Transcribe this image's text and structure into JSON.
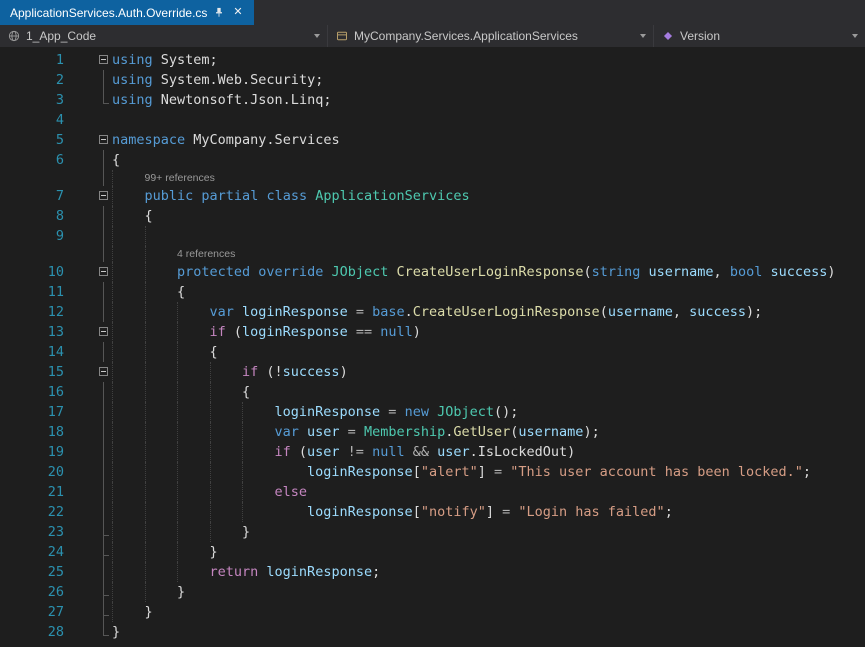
{
  "tab_bar": {
    "active_tab": {
      "title": "ApplicationServices.Auth.Override.cs",
      "pinned": true,
      "close_label": "✕"
    }
  },
  "nav_bar": {
    "dropdowns": [
      {
        "label": "1_App_Code",
        "icon": "globe-icon"
      },
      {
        "label": "MyCompany.Services.ApplicationServices",
        "icon": "class-icon"
      },
      {
        "label": "Version",
        "icon": "member-icon"
      }
    ]
  },
  "colors": {
    "tab_active_bg": "#0e62a0",
    "chrome_bg": "#2d2d30",
    "editor_bg": "#1e1e1e",
    "line_number": "#2b91af",
    "codelens": "#999999",
    "keyword": "#569cd6",
    "control": "#c586c0",
    "type": "#4ec9b0",
    "method": "#dcdcaa",
    "variable": "#9cdcfe",
    "string": "#d69d85",
    "operator": "#b4b4b4",
    "text": "#dcdcdc"
  },
  "editor": {
    "language": "C#",
    "lines": [
      {
        "num": 1,
        "fold": "box",
        "guides": 0,
        "tokens": [
          [
            "kw",
            "using"
          ],
          [
            "pl",
            " System;"
          ]
        ]
      },
      {
        "num": 2,
        "fold": "line",
        "guides": 0,
        "tokens": [
          [
            "kw",
            "using"
          ],
          [
            "pl",
            " System.Web.Security;"
          ]
        ]
      },
      {
        "num": 3,
        "fold": "end",
        "guides": 0,
        "tokens": [
          [
            "kw",
            "using"
          ],
          [
            "pl",
            " Newtonsoft.Json.Linq;"
          ]
        ]
      },
      {
        "num": 4,
        "fold": "none",
        "guides": 0,
        "tokens": []
      },
      {
        "num": 5,
        "fold": "box",
        "guides": 0,
        "tokens": [
          [
            "kw",
            "namespace"
          ],
          [
            "pl",
            " MyCompany.Services"
          ]
        ]
      },
      {
        "num": 6,
        "fold": "line",
        "guides": 0,
        "tokens": [
          [
            "pl",
            "{"
          ]
        ]
      },
      {
        "num": 7,
        "fold": "box",
        "guides": 1,
        "lens": "99+ references",
        "tokens": [
          [
            "kw",
            "public"
          ],
          [
            "pl",
            " "
          ],
          [
            "kw",
            "partial"
          ],
          [
            "pl",
            " "
          ],
          [
            "kw",
            "class"
          ],
          [
            "pl",
            " "
          ],
          [
            "type",
            "ApplicationServices"
          ]
        ]
      },
      {
        "num": 8,
        "fold": "line",
        "guides": 1,
        "tokens": [
          [
            "pl",
            "{"
          ]
        ]
      },
      {
        "num": 9,
        "fold": "line",
        "guides": 2,
        "tokens": []
      },
      {
        "num": 10,
        "fold": "box",
        "guides": 2,
        "lens": "4 references",
        "tokens": [
          [
            "kw",
            "protected"
          ],
          [
            "pl",
            " "
          ],
          [
            "kw",
            "override"
          ],
          [
            "pl",
            " "
          ],
          [
            "type",
            "JObject"
          ],
          [
            "pl",
            " "
          ],
          [
            "m",
            "CreateUserLoginResponse"
          ],
          [
            "pl",
            "("
          ],
          [
            "kw",
            "string"
          ],
          [
            "pl",
            " "
          ],
          [
            "v",
            "username"
          ],
          [
            "pl",
            ", "
          ],
          [
            "kw",
            "bool"
          ],
          [
            "pl",
            " "
          ],
          [
            "v",
            "success"
          ],
          [
            "pl",
            ")"
          ]
        ]
      },
      {
        "num": 11,
        "fold": "line",
        "guides": 2,
        "tokens": [
          [
            "pl",
            "{"
          ]
        ]
      },
      {
        "num": 12,
        "fold": "line",
        "guides": 3,
        "tokens": [
          [
            "kw",
            "var"
          ],
          [
            "pl",
            " "
          ],
          [
            "v",
            "loginResponse"
          ],
          [
            "op",
            " = "
          ],
          [
            "kw",
            "base"
          ],
          [
            "pl",
            "."
          ],
          [
            "m",
            "CreateUserLoginResponse"
          ],
          [
            "pl",
            "("
          ],
          [
            "v",
            "username"
          ],
          [
            "pl",
            ", "
          ],
          [
            "v",
            "success"
          ],
          [
            "pl",
            ");"
          ]
        ]
      },
      {
        "num": 13,
        "fold": "box",
        "guides": 3,
        "tokens": [
          [
            "ctrl",
            "if"
          ],
          [
            "pl",
            " ("
          ],
          [
            "v",
            "loginResponse"
          ],
          [
            "op",
            " == "
          ],
          [
            "kw",
            "null"
          ],
          [
            "pl",
            ")"
          ]
        ]
      },
      {
        "num": 14,
        "fold": "line",
        "guides": 3,
        "tokens": [
          [
            "pl",
            "{"
          ]
        ]
      },
      {
        "num": 15,
        "fold": "box",
        "guides": 4,
        "tokens": [
          [
            "ctrl",
            "if"
          ],
          [
            "pl",
            " (!"
          ],
          [
            "v",
            "success"
          ],
          [
            "pl",
            ")"
          ]
        ]
      },
      {
        "num": 16,
        "fold": "line",
        "guides": 4,
        "tokens": [
          [
            "pl",
            "{"
          ]
        ]
      },
      {
        "num": 17,
        "fold": "line",
        "guides": 5,
        "tokens": [
          [
            "v",
            "loginResponse"
          ],
          [
            "op",
            " = "
          ],
          [
            "kw",
            "new"
          ],
          [
            "pl",
            " "
          ],
          [
            "type",
            "JObject"
          ],
          [
            "pl",
            "();"
          ]
        ]
      },
      {
        "num": 18,
        "fold": "line",
        "guides": 5,
        "tokens": [
          [
            "kw",
            "var"
          ],
          [
            "pl",
            " "
          ],
          [
            "v",
            "user"
          ],
          [
            "op",
            " = "
          ],
          [
            "type",
            "Membership"
          ],
          [
            "pl",
            "."
          ],
          [
            "m",
            "GetUser"
          ],
          [
            "pl",
            "("
          ],
          [
            "v",
            "username"
          ],
          [
            "pl",
            ");"
          ]
        ]
      },
      {
        "num": 19,
        "fold": "line",
        "guides": 5,
        "tokens": [
          [
            "ctrl",
            "if"
          ],
          [
            "pl",
            " ("
          ],
          [
            "v",
            "user"
          ],
          [
            "op",
            " != "
          ],
          [
            "kw",
            "null"
          ],
          [
            "op",
            " && "
          ],
          [
            "v",
            "user"
          ],
          [
            "pl",
            ".IsLockedOut)"
          ]
        ]
      },
      {
        "num": 20,
        "fold": "line",
        "guides": 5,
        "tokens": [
          [
            "pl",
            "    "
          ],
          [
            "v",
            "loginResponse"
          ],
          [
            "pl",
            "["
          ],
          [
            "s",
            "\"alert\""
          ],
          [
            "pl",
            "]"
          ],
          [
            "op",
            " = "
          ],
          [
            "s",
            "\"This user account has been locked.\""
          ],
          [
            "pl",
            ";"
          ]
        ]
      },
      {
        "num": 21,
        "fold": "line",
        "guides": 5,
        "tokens": [
          [
            "ctrl",
            "else"
          ]
        ]
      },
      {
        "num": 22,
        "fold": "line",
        "guides": 5,
        "tokens": [
          [
            "pl",
            "    "
          ],
          [
            "v",
            "loginResponse"
          ],
          [
            "pl",
            "["
          ],
          [
            "s",
            "\"notify\""
          ],
          [
            "pl",
            "]"
          ],
          [
            "op",
            " = "
          ],
          [
            "s",
            "\"Login has failed\""
          ],
          [
            "pl",
            ";"
          ]
        ]
      },
      {
        "num": 23,
        "fold": "tick",
        "guides": 4,
        "tokens": [
          [
            "pl",
            "}"
          ]
        ]
      },
      {
        "num": 24,
        "fold": "tick",
        "guides": 3,
        "tokens": [
          [
            "pl",
            "}"
          ]
        ]
      },
      {
        "num": 25,
        "fold": "line",
        "guides": 3,
        "tokens": [
          [
            "ctrl",
            "return"
          ],
          [
            "pl",
            " "
          ],
          [
            "v",
            "loginResponse"
          ],
          [
            "pl",
            ";"
          ]
        ]
      },
      {
        "num": 26,
        "fold": "tick",
        "guides": 2,
        "tokens": [
          [
            "pl",
            "}"
          ]
        ]
      },
      {
        "num": 27,
        "fold": "tick",
        "guides": 1,
        "tokens": [
          [
            "pl",
            "}"
          ]
        ]
      },
      {
        "num": 28,
        "fold": "end",
        "guides": 0,
        "tokens": [
          [
            "pl",
            "}"
          ]
        ]
      }
    ]
  }
}
